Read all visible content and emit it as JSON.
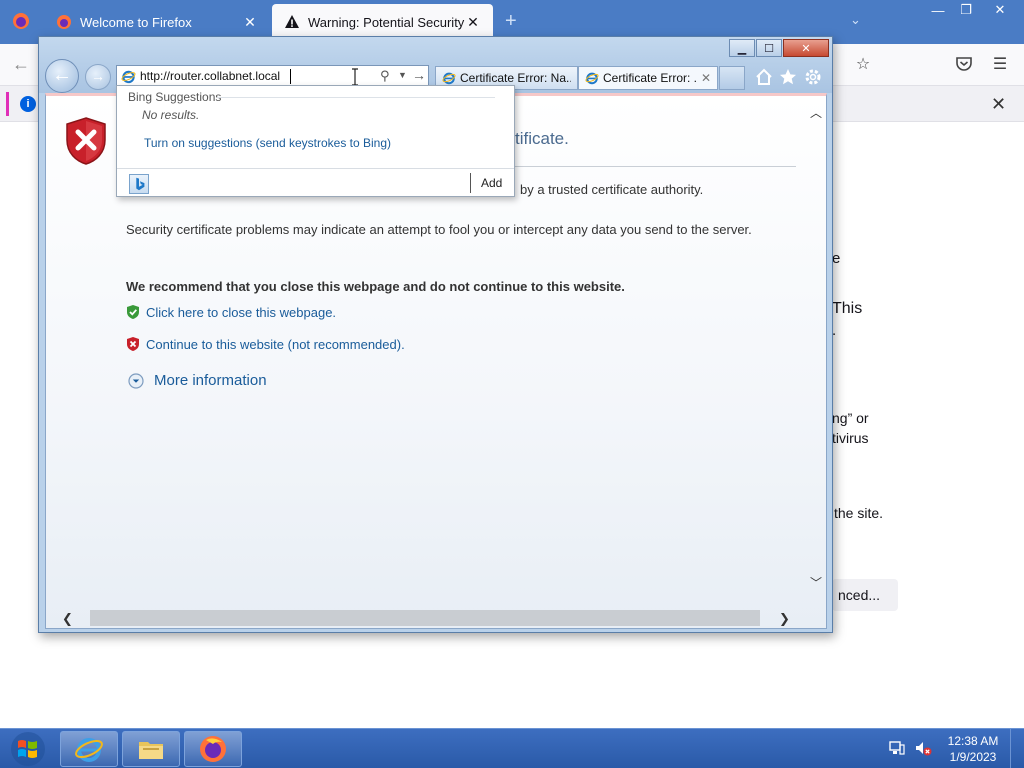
{
  "firefox": {
    "tabs": [
      {
        "title": "Welcome to Firefox",
        "icon": "firefox-icon",
        "active": false
      },
      {
        "title": "Warning: Potential Security Risk",
        "icon": "warning-icon",
        "active": true
      }
    ],
    "newtab_symbol": "+",
    "background_fragments": [
      "e",
      "This",
      ".",
      "ng” or",
      "tivirus",
      "the site.",
      "nced..."
    ]
  },
  "ie": {
    "address": "http://router.collabnet.local",
    "tabs": [
      {
        "title": "Certificate Error: Na...",
        "icon": "ie-icon"
      },
      {
        "title": "Certificate Error: ...",
        "icon": "ie-icon",
        "active": true
      }
    ],
    "page": {
      "heading_partial": "tificate.",
      "line1_partial": "by a trusted certificate authority.",
      "line2": "Security certificate problems may indicate an attempt to fool you or intercept any data you send to the server.",
      "recommend": "We recommend that you close this webpage and do not continue to this website.",
      "link_close": "Click here to close this webpage.",
      "link_continue": "Continue to this website (not recommended).",
      "more_info": "More information"
    },
    "dropdown": {
      "header": "Bing Suggestions",
      "no_results": "No results.",
      "turn_on": "Turn on suggestions (send keystrokes to Bing)",
      "add": "Add"
    }
  },
  "taskbar": {
    "time": "12:38 AM",
    "date": "1/9/2023"
  },
  "colors": {
    "ff_titlebar": "#4a7cc5",
    "taskbar": "#2a5aa8",
    "link": "#1a5c9a",
    "ie_close": "#c74a32"
  }
}
